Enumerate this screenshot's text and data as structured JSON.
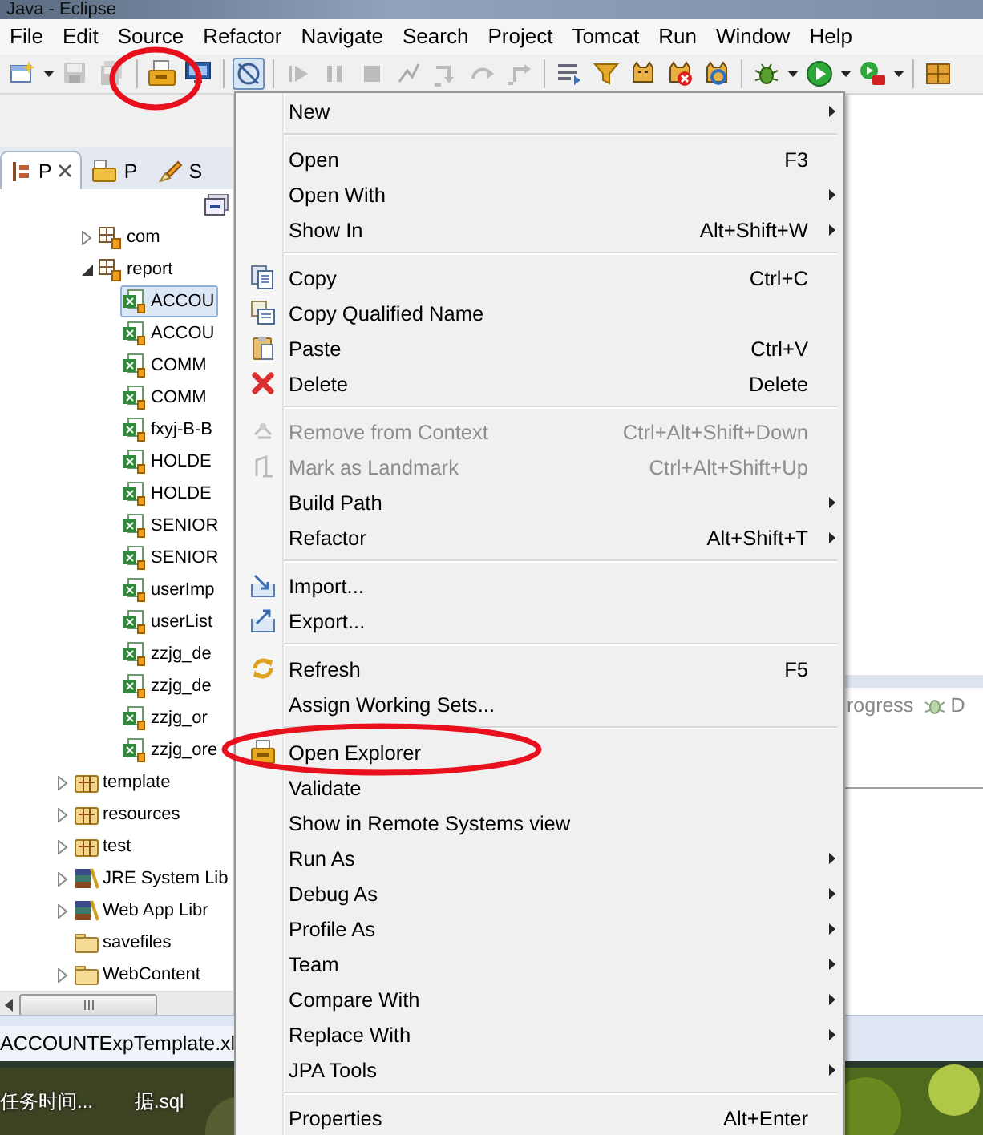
{
  "window": {
    "title": "Java - Eclipse"
  },
  "menu_bar": [
    {
      "label": "File"
    },
    {
      "label": "Edit"
    },
    {
      "label": "Source"
    },
    {
      "label": "Refactor"
    },
    {
      "label": "Navigate"
    },
    {
      "label": "Search"
    },
    {
      "label": "Project"
    },
    {
      "label": "Tomcat"
    },
    {
      "label": "Run"
    },
    {
      "label": "Window"
    },
    {
      "label": "Help"
    }
  ],
  "view_tabs": [
    {
      "label": "P",
      "selected": true
    },
    {
      "label": "P",
      "selected": false
    },
    {
      "label": "S",
      "selected": false
    }
  ],
  "tree": [
    {
      "children": [
        {
          "label": "com",
          "kind": "package",
          "expanded": false,
          "selected": false
        },
        {
          "label": "report",
          "kind": "package",
          "expanded": true,
          "selected": false,
          "children": [
            {
              "label": "ACCOU",
              "kind": "file",
              "selected": true
            },
            {
              "label": "ACCOU",
              "kind": "file",
              "selected": false
            },
            {
              "label": "COMM",
              "kind": "file",
              "selected": false
            },
            {
              "label": "COMM",
              "kind": "file",
              "selected": false
            },
            {
              "label": "fxyj-B-B",
              "kind": "file",
              "selected": false
            },
            {
              "label": "HOLDE",
              "kind": "file",
              "selected": false
            },
            {
              "label": "HOLDE",
              "kind": "file",
              "selected": false
            },
            {
              "label": "SENIOR",
              "kind": "file",
              "selected": false
            },
            {
              "label": "SENIOR",
              "kind": "file",
              "selected": false
            },
            {
              "label": "userImp",
              "kind": "file",
              "selected": false
            },
            {
              "label": "userList",
              "kind": "file",
              "selected": false
            },
            {
              "label": "zzjg_de",
              "kind": "file",
              "selected": false
            },
            {
              "label": "zzjg_de",
              "kind": "file",
              "selected": false
            },
            {
              "label": "zzjg_or",
              "kind": "file",
              "selected": false
            },
            {
              "label": "zzjg_ore",
              "kind": "file",
              "selected": false
            }
          ]
        }
      ]
    },
    {
      "label": "template",
      "kind": "source",
      "expanded": false,
      "selected": false
    },
    {
      "label": "resources",
      "kind": "source",
      "expanded": false,
      "selected": false
    },
    {
      "label": "test",
      "kind": "source",
      "expanded": false,
      "selected": false
    },
    {
      "label": "JRE System Lib",
      "kind": "library",
      "expanded": false,
      "selected": false
    },
    {
      "label": "Web App Libr",
      "kind": "library",
      "expanded": false,
      "selected": false
    },
    {
      "label": "savefiles",
      "kind": "folder",
      "selected": false
    },
    {
      "label": "WebContent",
      "kind": "folder",
      "expanded": false,
      "selected": false
    }
  ],
  "right_panel": {
    "tabs": [
      {
        "label": "rogress"
      },
      {
        "label": "D"
      }
    ]
  },
  "editor_tabs": [
    {
      "label": "ACCOUNTExpTemplate.xl"
    }
  ],
  "desktop": {
    "icons": [
      {
        "label": "任务时间..."
      },
      {
        "label": "据.sql"
      }
    ]
  },
  "context_menu": {
    "groups": [
      [
        {
          "label": "New",
          "submenu": true,
          "disabled": false
        }
      ],
      [
        {
          "label": "Open",
          "shortcut": "F3",
          "submenu": false,
          "disabled": false
        },
        {
          "label": "Open With",
          "submenu": true,
          "disabled": false
        },
        {
          "label": "Show In",
          "shortcut": "Alt+Shift+W",
          "submenu": true,
          "disabled": false
        }
      ],
      [
        {
          "label": "Copy",
          "shortcut": "Ctrl+C",
          "submenu": false,
          "disabled": false
        },
        {
          "label": "Copy Qualified Name",
          "submenu": false,
          "disabled": false
        },
        {
          "label": "Paste",
          "shortcut": "Ctrl+V",
          "submenu": false,
          "disabled": false
        },
        {
          "label": "Delete",
          "shortcut": "Delete",
          "submenu": false,
          "disabled": false
        }
      ],
      [
        {
          "label": "Remove from Context",
          "shortcut": "Ctrl+Alt+Shift+Down",
          "submenu": false,
          "disabled": true
        },
        {
          "label": "Mark as Landmark",
          "shortcut": "Ctrl+Alt+Shift+Up",
          "submenu": false,
          "disabled": true
        },
        {
          "label": "Build Path",
          "submenu": true,
          "disabled": false
        },
        {
          "label": "Refactor",
          "shortcut": "Alt+Shift+T",
          "submenu": true,
          "disabled": false
        }
      ],
      [
        {
          "label": "Import...",
          "submenu": false,
          "disabled": false
        },
        {
          "label": "Export...",
          "submenu": false,
          "disabled": false
        }
      ],
      [
        {
          "label": "Refresh",
          "shortcut": "F5",
          "submenu": false,
          "disabled": false
        },
        {
          "label": "Assign Working Sets...",
          "submenu": false,
          "disabled": false
        }
      ],
      [
        {
          "label": "Open Explorer",
          "submenu": false,
          "disabled": false
        },
        {
          "label": "Validate",
          "submenu": false,
          "disabled": false
        },
        {
          "label": "Show in Remote Systems view",
          "submenu": false,
          "disabled": false
        },
        {
          "label": "Run As",
          "submenu": true,
          "disabled": false
        },
        {
          "label": "Debug As",
          "submenu": true,
          "disabled": false
        },
        {
          "label": "Profile As",
          "submenu": true,
          "disabled": false
        },
        {
          "label": "Team",
          "submenu": true,
          "disabled": false
        },
        {
          "label": "Compare With",
          "submenu": true,
          "disabled": false
        },
        {
          "label": "Replace With",
          "submenu": true,
          "disabled": false
        },
        {
          "label": "JPA Tools",
          "submenu": true,
          "disabled": false
        }
      ],
      [
        {
          "label": "Properties",
          "shortcut": "Alt+Enter",
          "submenu": false,
          "disabled": false
        }
      ]
    ]
  }
}
